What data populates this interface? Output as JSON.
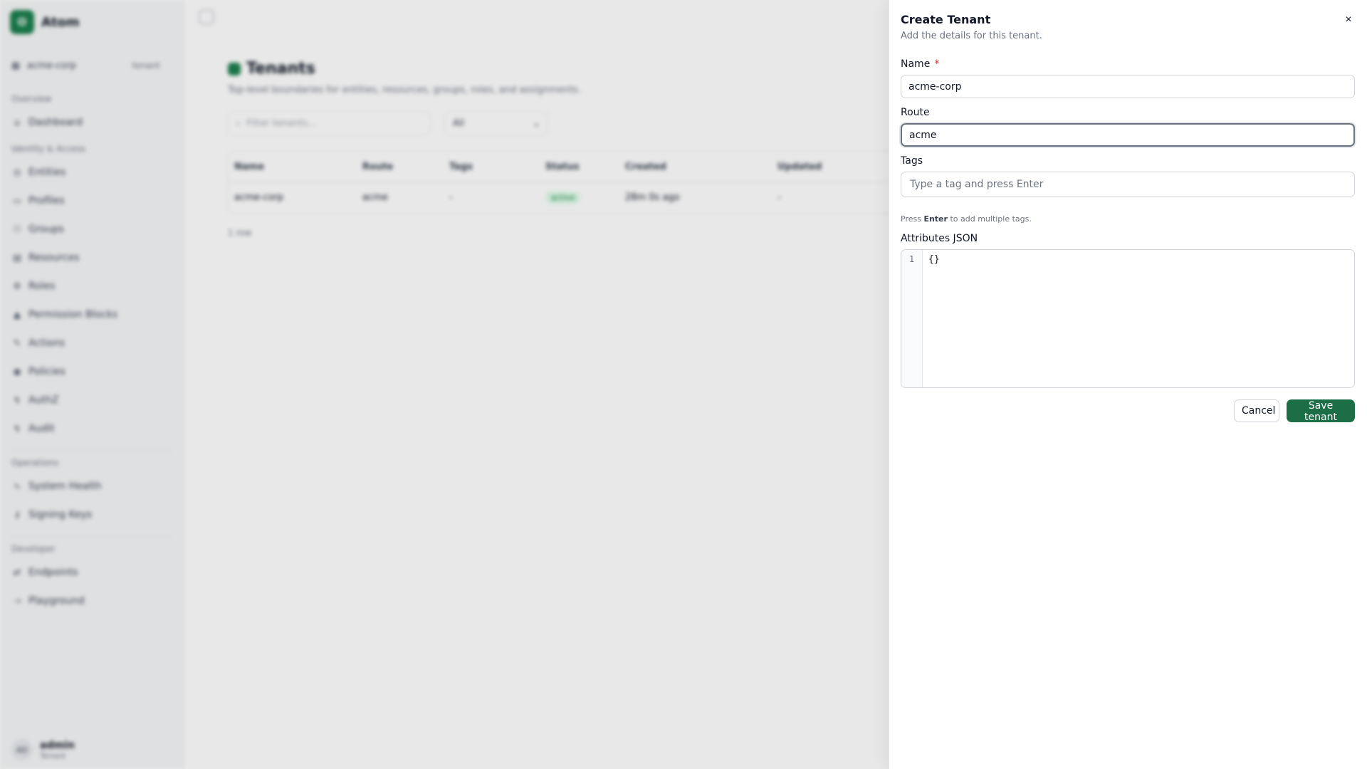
{
  "app": {
    "brand_initial": "O",
    "brand_name": "Atom"
  },
  "sidebar": {
    "tenant_name": "acme-corp",
    "tenant_badge": "tenant",
    "sections": [
      {
        "label": "Overview",
        "items": [
          {
            "label": "Dashboard",
            "icon": "home-icon"
          }
        ]
      },
      {
        "label": "Identity & Access",
        "items": [
          {
            "label": "Entities",
            "icon": "entities-icon"
          },
          {
            "label": "Profiles",
            "icon": "profiles-icon"
          },
          {
            "label": "Groups",
            "icon": "groups-icon"
          },
          {
            "label": "Resources",
            "icon": "resources-icon"
          },
          {
            "label": "Roles",
            "icon": "roles-icon"
          },
          {
            "label": "Permission Blocks",
            "icon": "lock-icon"
          },
          {
            "label": "Actions",
            "icon": "actions-icon"
          },
          {
            "label": "Policies",
            "icon": "policies-icon"
          },
          {
            "label": "AuthZ",
            "icon": "authz-icon"
          },
          {
            "label": "Audit",
            "icon": "audit-icon"
          }
        ]
      },
      {
        "label": "Operations",
        "items": [
          {
            "label": "System Health",
            "icon": "health-icon"
          },
          {
            "label": "Signing Keys",
            "icon": "key-icon"
          }
        ]
      },
      {
        "label": "Developer",
        "items": [
          {
            "label": "Endpoints",
            "icon": "endpoints-icon"
          },
          {
            "label": "Playground",
            "icon": "playground-icon"
          }
        ]
      }
    ],
    "user": {
      "initials": "AD",
      "name": "admin",
      "role": "Tenant"
    }
  },
  "page": {
    "title": "Tenants",
    "subtitle": "Top-level boundaries for entities, resources, groups, roles, and assignments.",
    "filter_placeholder": "Filter tenants...",
    "filter_select": "All",
    "columns": [
      "Name",
      "Route",
      "Tags",
      "Status",
      "Created",
      "Updated"
    ],
    "rows": [
      {
        "name": "acme-corp",
        "route": "acme",
        "tags": "-",
        "status": "active",
        "created": "28m 0s ago",
        "updated": "-"
      }
    ],
    "row_count": "1 row"
  },
  "drawer": {
    "title": "Create Tenant",
    "subtitle": "Add the details for this tenant.",
    "close_icon": "×",
    "name_label": "Name",
    "required_mark": "*",
    "name_value": "acme-corp",
    "route_label": "Route",
    "route_value": "acme",
    "tags_label": "Tags",
    "tags_placeholder": "Type a tag and press Enter",
    "tags_help_prefix": "Press",
    "tags_help_key": "Enter",
    "tags_help_suffix": "to add multiple tags.",
    "json_label": "Attributes JSON",
    "json_line_number": "1",
    "json_value": "{}",
    "cancel_label": "Cancel",
    "save_label": "Save tenant"
  },
  "colors": {
    "brand": "#1b7f4e",
    "save_button": "#1b6e46",
    "required": "#dc2626"
  }
}
